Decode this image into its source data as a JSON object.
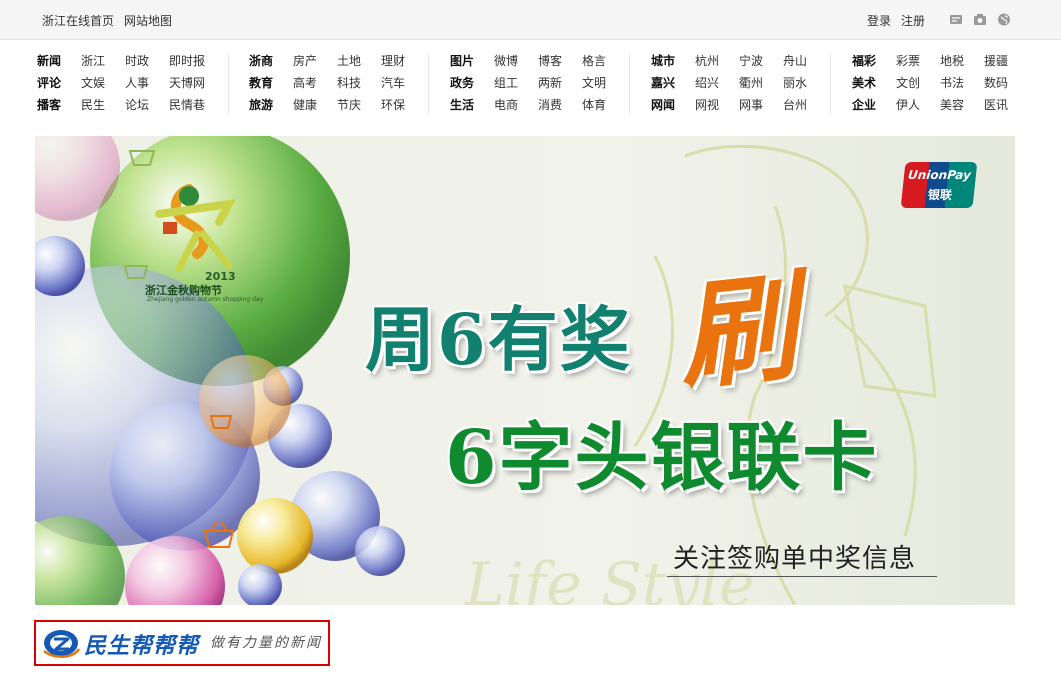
{
  "topbar": {
    "left_links": [
      "浙江在线首页",
      "网站地图"
    ],
    "right_links": [
      "登录",
      "注册"
    ],
    "icons": [
      "mail-icon",
      "camera-icon",
      "globe-icon"
    ]
  },
  "nav": {
    "groups": [
      [
        [
          "新闻",
          "浙江",
          "时政",
          "即时报"
        ],
        [
          "评论",
          "文娱",
          "人事",
          "天博网"
        ],
        [
          "播客",
          "民生",
          "论坛",
          "民情巷"
        ]
      ],
      [
        [
          "浙商",
          "房产",
          "土地",
          "理财"
        ],
        [
          "教育",
          "高考",
          "科技",
          "汽车"
        ],
        [
          "旅游",
          "健康",
          "节庆",
          "环保"
        ]
      ],
      [
        [
          "图片",
          "微博",
          "博客",
          "格言"
        ],
        [
          "政务",
          "组工",
          "两新",
          "文明"
        ],
        [
          "生活",
          "电商",
          "消费",
          "体育"
        ]
      ],
      [
        [
          "城市",
          "杭州",
          "宁波",
          "舟山"
        ],
        [
          "嘉兴",
          "绍兴",
          "衢州",
          "丽水"
        ],
        [
          "网闻",
          "网视",
          "网事",
          "台州"
        ]
      ],
      [
        [
          "福彩",
          "彩票",
          "地税",
          "援疆"
        ],
        [
          "美术",
          "文创",
          "书法",
          "数码"
        ],
        [
          "企业",
          "伊人",
          "美容",
          "医讯"
        ]
      ]
    ]
  },
  "banner": {
    "headline_line1": "周6有奖",
    "headline_brush": "刷",
    "headline_line2": "6字头银联卡",
    "subline": "关注签购单中奖信息",
    "unionpay_en": "UnionPay",
    "unionpay_cn": "银联",
    "festival_year": "2013",
    "festival_name": "浙江金秋购物节",
    "festival_en": "Zhejiang golden autumn shopping day",
    "bg_text": "Life Style"
  },
  "logo": {
    "name": "民生帮帮帮",
    "slogan": "做有力量的新闻"
  },
  "colors": {
    "accent_teal": "#12806f",
    "accent_orange": "#e8730f",
    "accent_green": "#0f8a2e",
    "logo_border": "#d90000",
    "logo_blue": "#1559b7"
  }
}
